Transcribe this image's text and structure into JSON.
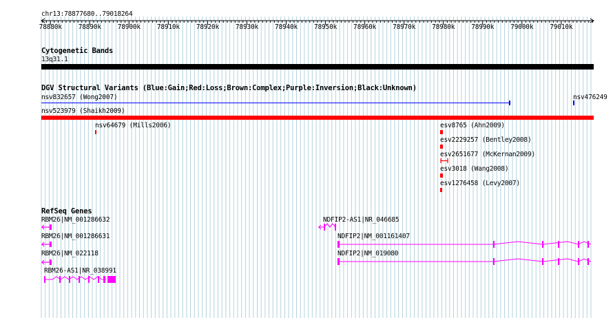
{
  "region": "chr13:78877680..79018264",
  "ruler": {
    "ticks": [
      "78880k",
      "78890k",
      "78900k",
      "78910k",
      "78920k",
      "78930k",
      "78940k",
      "78950k",
      "78960k",
      "78970k",
      "78980k",
      "78990k",
      "79000k",
      "79010k"
    ],
    "start": 78877680,
    "end": 79018264
  },
  "tracks": {
    "cytoband": {
      "title": "Cytogenetic Bands",
      "band": "13q31.1"
    },
    "dgv": {
      "title": "DGV Structural Variants (Blue:Gain;Red:Loss;Brown:Complex;Purple:Inversion;Black:Unknown)",
      "variants": [
        {
          "label": "nsv832657 (Wong2007)",
          "type": "Gain"
        },
        {
          "label": "nsv476249",
          "type": "Gain"
        },
        {
          "label": "nsv523979 (Shaikh2009)",
          "type": "Loss"
        },
        {
          "label": "nsv64679 (Mills2006)",
          "type": "Loss"
        },
        {
          "label": "esv8765 (Ahn2009)",
          "type": "Loss"
        },
        {
          "label": "esv2229257 (Bentley2008)",
          "type": "Loss"
        },
        {
          "label": "esv2651677 (McKernan2009)",
          "type": "Loss"
        },
        {
          "label": "esv3018 (Wang2008)",
          "type": "Loss"
        },
        {
          "label": "esv1276458 (Levy2007)",
          "type": "Loss"
        }
      ]
    },
    "refseq": {
      "title": "RefSeq Genes",
      "genes": [
        {
          "label": "RBM26|NM_001286632",
          "strand": "-"
        },
        {
          "label": "NDFIP2-AS1|NR_046685",
          "strand": "-"
        },
        {
          "label": "RBM26|NM_001286631",
          "strand": "-"
        },
        {
          "label": "NDFIP2|NM_001161407",
          "strand": "+"
        },
        {
          "label": "RBM26|NM_022118",
          "strand": "-"
        },
        {
          "label": "NDFIP2|NM_019080",
          "strand": "+"
        },
        {
          "label": "RBM26-AS1|NR_038991",
          "strand": "+"
        }
      ]
    }
  },
  "colors": {
    "grid": "#b4d2dc",
    "gain": "#0000ff",
    "loss": "#ff0000",
    "gene": "#ff00ff",
    "band": "#000000"
  }
}
